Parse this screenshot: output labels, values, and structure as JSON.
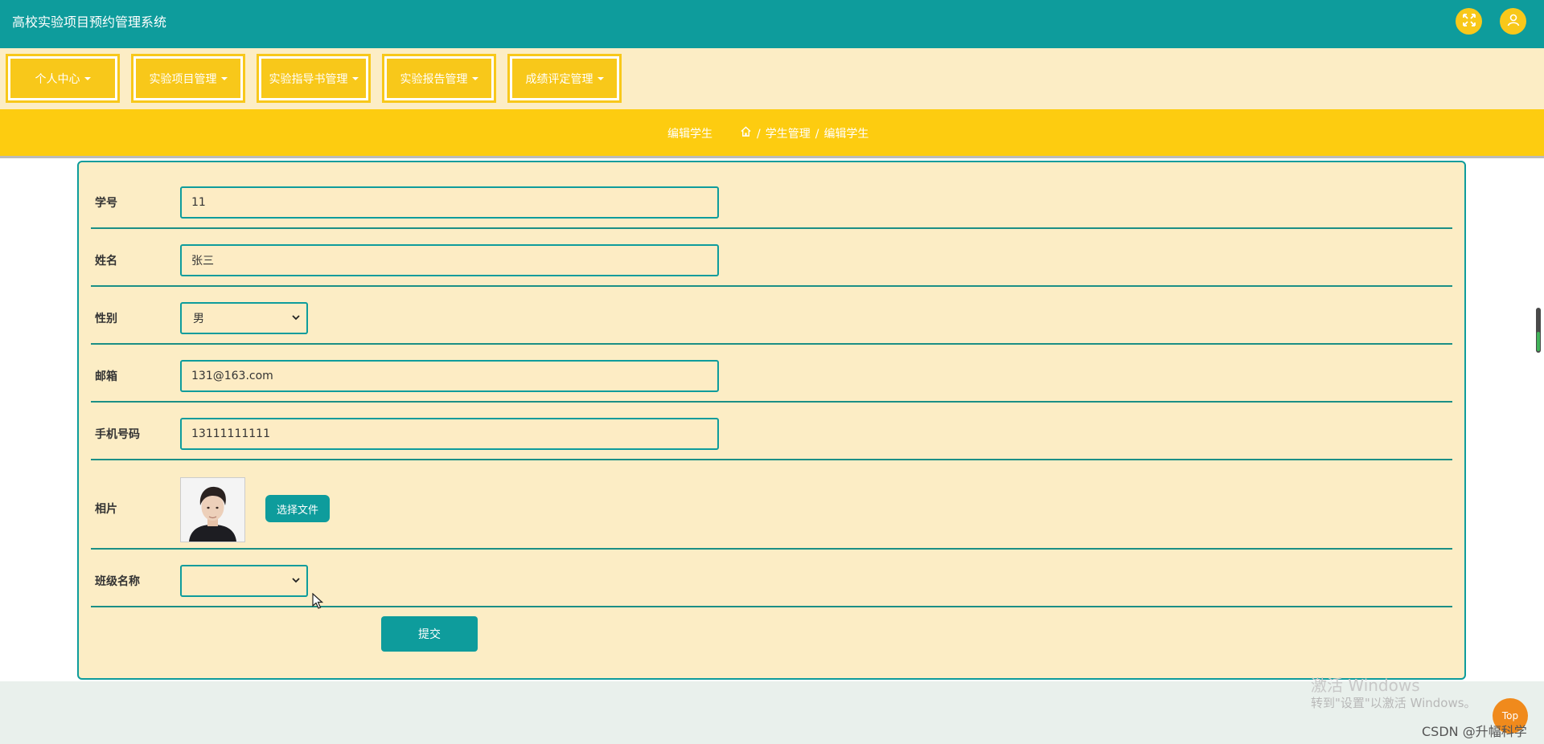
{
  "app": {
    "title": "高校实验项目预约管理系统"
  },
  "header": {
    "fullscreen_icon": "fullscreen-icon",
    "user_icon": "user-icon"
  },
  "nav": [
    {
      "label": "个人中心"
    },
    {
      "label": "实验项目管理"
    },
    {
      "label": "实验指导书管理"
    },
    {
      "label": "实验报告管理"
    },
    {
      "label": "成绩评定管理"
    }
  ],
  "breadcrumb": {
    "title": "编辑学生",
    "home_icon": "home-icon",
    "separator": "/",
    "items": [
      "学生管理",
      "编辑学生"
    ]
  },
  "form": {
    "student_id": {
      "label": "学号",
      "value": "11"
    },
    "name": {
      "label": "姓名",
      "value": "张三"
    },
    "gender": {
      "label": "性别",
      "value": "男"
    },
    "email": {
      "label": "邮箱",
      "value": "131@163.com"
    },
    "phone": {
      "label": "手机号码",
      "value": "13111111111"
    },
    "photo": {
      "label": "相片",
      "button": "选择文件"
    },
    "class_name": {
      "label": "班级名称",
      "value": ""
    },
    "submit": "提交"
  },
  "overlay": {
    "watermark_line1": "激活 Windows",
    "watermark_line2": "转到\"设置\"以激活 Windows。",
    "top_button": "Top",
    "csdn": "CSDN @升幅科学"
  },
  "colors": {
    "header_bg": "#0e9c9c",
    "accent_yellow": "#f8c81a",
    "panel_bg": "#fcedc5"
  }
}
